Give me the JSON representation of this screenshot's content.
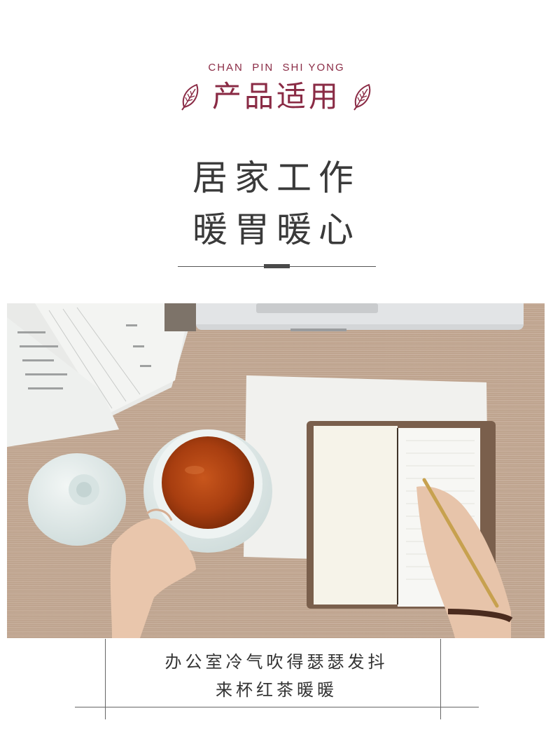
{
  "header": {
    "pinyin": "CHAN  PIN  SHI YONG",
    "title": "产品适用",
    "accent_color": "#8a2b45",
    "left_icon": "leaf-icon",
    "right_icon": "leaf-icon"
  },
  "headline": {
    "line1": "居家工作",
    "line2": "暖胃暖心"
  },
  "photo": {
    "description_icon": "tea-cup-notebook-photo"
  },
  "caption": {
    "line1": "办公室冷气吹得瑟瑟发抖",
    "line2": "来杯红茶暖暖"
  }
}
